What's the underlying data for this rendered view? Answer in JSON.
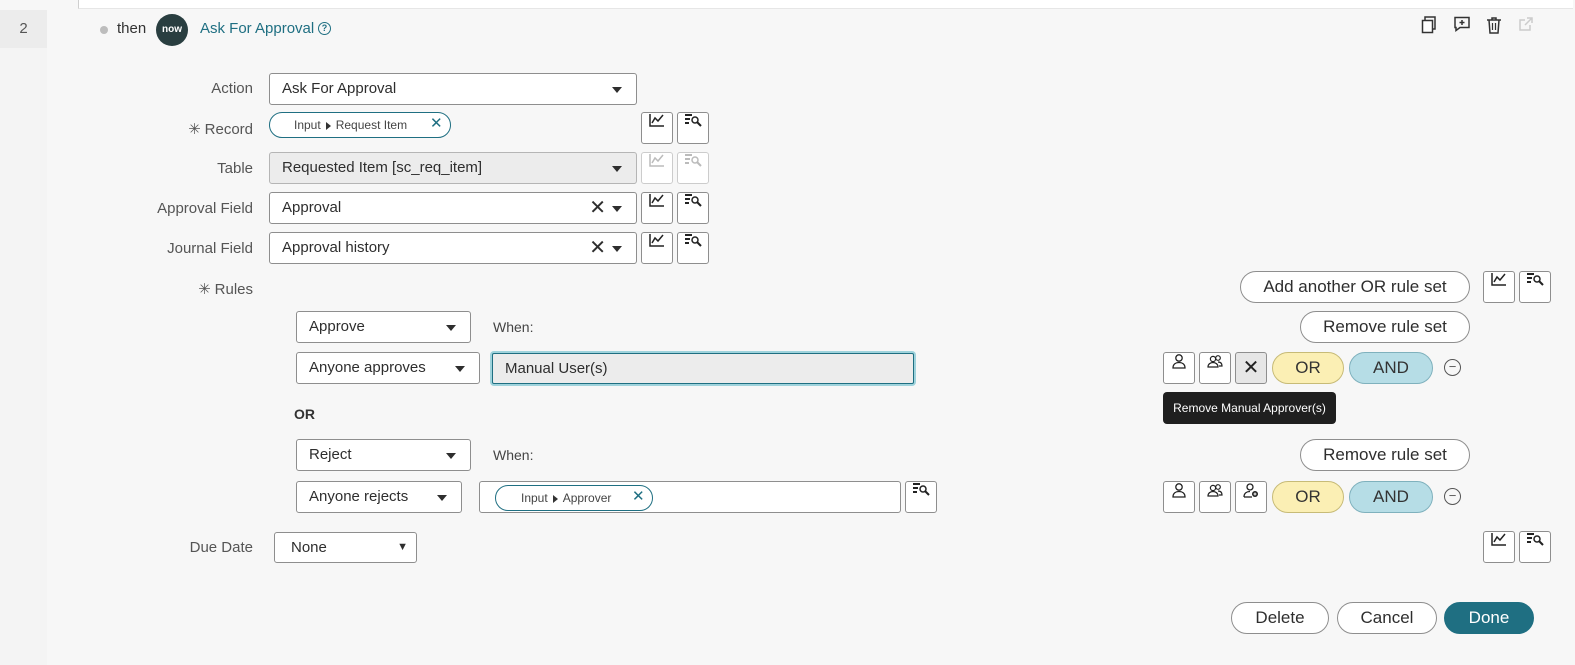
{
  "step": {
    "number": "2",
    "connector": "then",
    "logo_text": "now",
    "title": "Ask For Approval",
    "help_icon": "question-circle-icon"
  },
  "header_icons": [
    "copy-icon",
    "add-comment-icon",
    "trash-icon",
    "open-external-icon"
  ],
  "fields": {
    "action": {
      "label": "Action",
      "value": "Ask For Approval"
    },
    "record": {
      "label": "Record",
      "pill_part1": "Input",
      "pill_part2": "Request Item"
    },
    "table": {
      "label": "Table",
      "value": "Requested Item [sc_req_item]"
    },
    "approval_field": {
      "label": "Approval Field",
      "value": "Approval"
    },
    "journal_field": {
      "label": "Journal Field",
      "value": "Approval history"
    },
    "rules": {
      "label": "Rules"
    },
    "due_date": {
      "label": "Due Date",
      "value": "None"
    }
  },
  "rules": {
    "add_or_rule_set": "Add another OR rule set",
    "remove_rule_set": "Remove rule set",
    "when_label": "When:",
    "or_separator": "OR",
    "or_button": "OR",
    "and_button": "AND",
    "approve": {
      "action": "Approve",
      "condition": "Anyone approves",
      "approver_value": "Manual User(s)"
    },
    "reject": {
      "action": "Reject",
      "condition": "Anyone rejects",
      "pill_part1": "Input",
      "pill_part2": "Approver"
    },
    "tooltip": "Remove Manual Approver(s)"
  },
  "footer": {
    "delete": "Delete",
    "cancel": "Cancel",
    "done": "Done"
  },
  "colors": {
    "accent": "#1f6f82",
    "or_fill": "#fbefb4",
    "and_fill": "#b6dde6",
    "tooltip_bg": "#1f1f1f"
  }
}
